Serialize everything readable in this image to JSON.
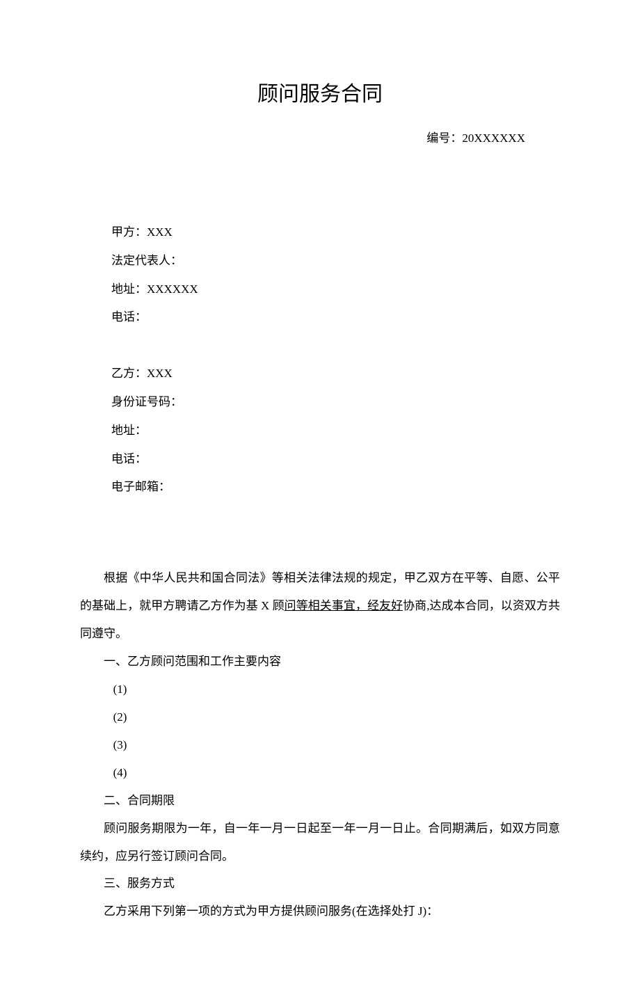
{
  "title": "顾问服务合同",
  "number_label": "编号：",
  "number_value": "20XXXXXX",
  "partyA": {
    "name_label": "甲方：",
    "name_value": "XXX",
    "rep_label": "法定代表人：",
    "rep_value": "",
    "addr_label": "地址：",
    "addr_value": "XXXXXX",
    "phone_label": "电话：",
    "phone_value": ""
  },
  "partyB": {
    "name_label": "乙方：",
    "name_value": "XXX",
    "id_label": "身份证号码：",
    "id_value": "",
    "addr_label": "地址：",
    "addr_value": "",
    "phone_label": "电话：",
    "phone_value": "",
    "email_label": "电子邮箱：",
    "email_value": ""
  },
  "intro": {
    "pre": "根据《中华人民共和国合同法》等相关法律法规的规定，甲乙双方在平等、自愿、公平的基础上，就甲方聘请乙方作为基 X 顾",
    "underlined": "问等相关事宜，经友好",
    "post": "协商,达成本合同，以资双方共同遵守。"
  },
  "section1": {
    "heading": "一、乙方顾问范围和工作主要内容",
    "items": [
      "(1)",
      "(2)",
      "(3)",
      "(4)"
    ]
  },
  "section2": {
    "heading": "二、合同期限",
    "body": "顾问服务期限为一年，自一年一月一日起至一年一月一日止。合同期满后，如双方同意续约，应另行签订顾问合同。"
  },
  "section3": {
    "heading": "三、服务方式",
    "body": "乙方采用下列第一项的方式为甲方提供顾问服务(在选择处打 J)："
  }
}
